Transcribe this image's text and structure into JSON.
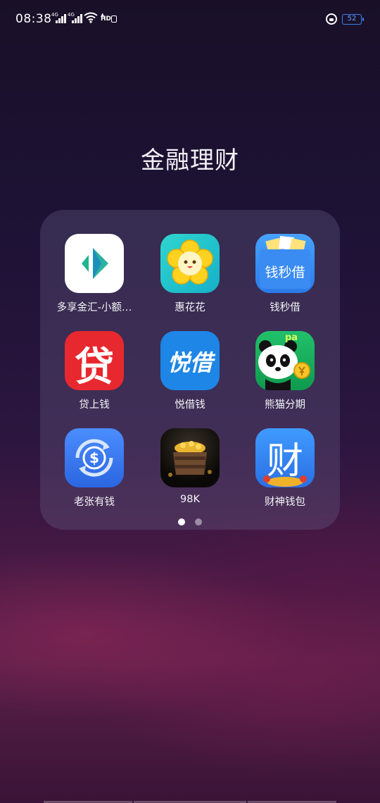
{
  "status_bar": {
    "time": "08:38",
    "network_1": "4G",
    "network_2": "4G",
    "hd_label": "HD",
    "battery": "52",
    "icons": [
      "signal-icon",
      "wifi-icon",
      "hd-icon",
      "lock-rotation-icon",
      "battery-icon"
    ]
  },
  "folder": {
    "title": "金融理财",
    "apps": [
      {
        "label": "多享金汇-小额…",
        "icon": "duoxiang-app-icon"
      },
      {
        "label": "惠花花",
        "icon": "flower-app-icon"
      },
      {
        "label": "钱秒借",
        "icon": "qianmiaojie-app-icon"
      },
      {
        "label": "贷上钱",
        "icon": "daishangqian-app-icon"
      },
      {
        "label": "悦借钱",
        "icon": "yuejieqian-app-icon"
      },
      {
        "label": "熊猫分期",
        "icon": "panda-app-icon"
      },
      {
        "label": "老张有钱",
        "icon": "dollar-app-icon"
      },
      {
        "label": "98K",
        "icon": "treasure-chest-app-icon"
      },
      {
        "label": "财神钱包",
        "icon": "caishen-app-icon"
      }
    ],
    "icon_text": {
      "qianmiaojie": "钱秒借",
      "daishangqian": "贷",
      "yuejieqian": "悦借",
      "panda_tag": "pa",
      "caishen": "财"
    },
    "pagination": {
      "current": 1,
      "total": 2
    }
  },
  "colors": {
    "accent_battery": "#3b82f6"
  }
}
